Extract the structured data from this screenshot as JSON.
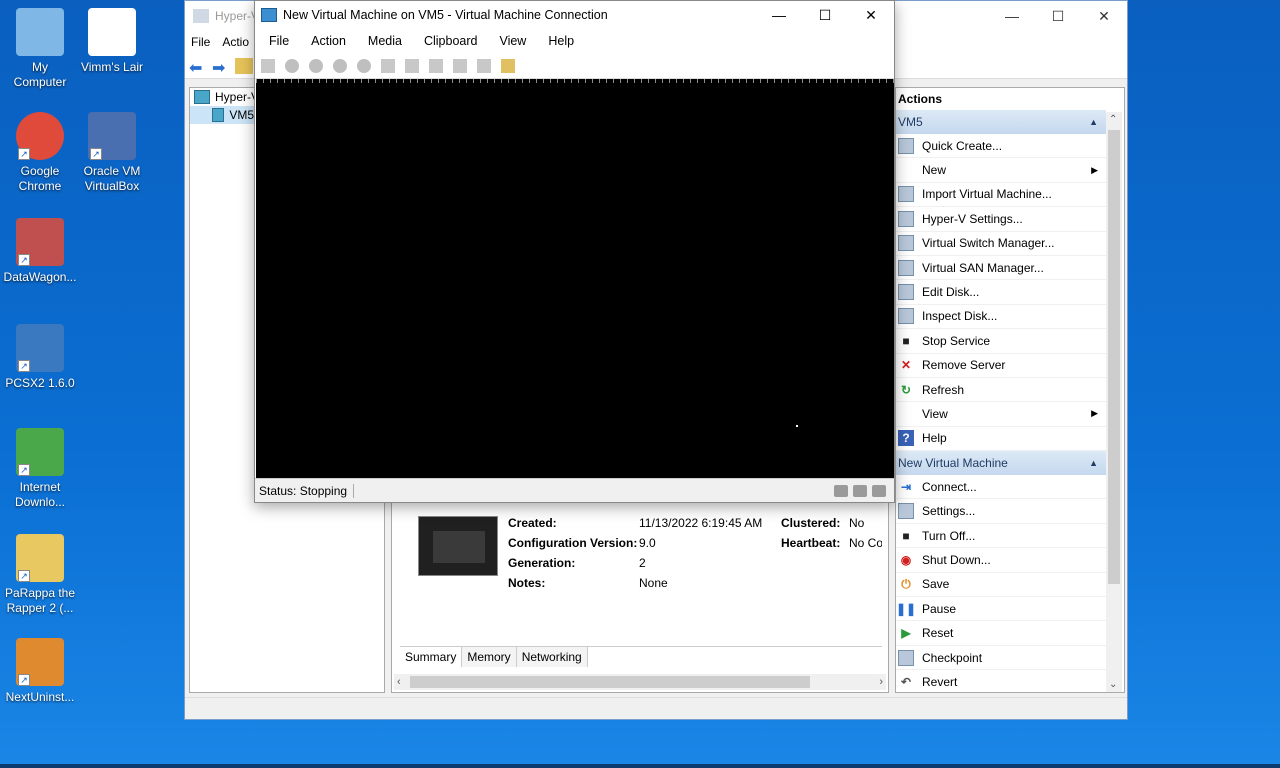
{
  "desktop": {
    "icons": [
      {
        "label": "My\nComputer",
        "name": "my-computer"
      },
      {
        "label": "Vimm's Lair",
        "name": "vimms-lair"
      },
      {
        "label": "Google\nChrome",
        "name": "google-chrome"
      },
      {
        "label": "Oracle VM\nVirtualBox",
        "name": "oracle-vm-virtualbox"
      },
      {
        "label": "DataWagon...",
        "name": "datawagon"
      },
      {
        "label": "PCSX2 1.6.0",
        "name": "pcsx2"
      },
      {
        "label": "Internet\nDownlo...",
        "name": "internet-download-manager"
      },
      {
        "label": "PaRappa the\nRapper 2 (...",
        "name": "parappa-the-rapper-2"
      },
      {
        "label": "NextUninst...",
        "name": "nextuninstaller"
      }
    ]
  },
  "manager": {
    "title": "Hyper-V",
    "menu": [
      "File",
      "Actio"
    ],
    "tree": [
      "Hyper-V",
      "VM5"
    ],
    "details": {
      "created_label": "Created:",
      "created_value": "11/13/2022 6:19:45 AM",
      "config_label": "Configuration Version:",
      "config_value": "9.0",
      "gen_label": "Generation:",
      "gen_value": "2",
      "notes_label": "Notes:",
      "notes_value": "None",
      "clustered_label": "Clustered:",
      "clustered_value": "No",
      "heartbeat_label": "Heartbeat:",
      "heartbeat_value": "No Conta"
    },
    "tabs": [
      "Summary",
      "Memory",
      "Networking"
    ],
    "actions_title": "Actions",
    "section_vm5": "VM5",
    "vm5_actions": [
      {
        "label": "Quick Create...",
        "icon": "quick-create-icon",
        "sub": false
      },
      {
        "label": "New",
        "icon": "new-icon",
        "sub": true
      },
      {
        "label": "Import Virtual Machine...",
        "icon": "import-icon",
        "sub": false
      },
      {
        "label": "Hyper-V Settings...",
        "icon": "settings-doc-icon",
        "sub": false
      },
      {
        "label": "Virtual Switch Manager...",
        "icon": "switch-icon",
        "sub": false
      },
      {
        "label": "Virtual SAN Manager...",
        "icon": "san-icon",
        "sub": false
      },
      {
        "label": "Edit Disk...",
        "icon": "edit-disk-icon",
        "sub": false
      },
      {
        "label": "Inspect Disk...",
        "icon": "inspect-disk-icon",
        "sub": false
      },
      {
        "label": "Stop Service",
        "icon": "stop-icon",
        "sub": false
      },
      {
        "label": "Remove Server",
        "icon": "remove-icon",
        "sub": false
      },
      {
        "label": "Refresh",
        "icon": "refresh-icon",
        "sub": false
      },
      {
        "label": "View",
        "icon": "view-icon",
        "sub": true
      },
      {
        "label": "Help",
        "icon": "help-icon",
        "sub": false
      }
    ],
    "section_vm": "New Virtual Machine",
    "vm_actions": [
      {
        "label": "Connect...",
        "icon": "connect-icon"
      },
      {
        "label": "Settings...",
        "icon": "settings-icon"
      },
      {
        "label": "Turn Off...",
        "icon": "turn-off-icon"
      },
      {
        "label": "Shut Down...",
        "icon": "shut-down-icon"
      },
      {
        "label": "Save",
        "icon": "save-icon"
      },
      {
        "label": "Pause",
        "icon": "pause-icon"
      },
      {
        "label": "Reset",
        "icon": "reset-icon"
      },
      {
        "label": "Checkpoint",
        "icon": "checkpoint-icon"
      },
      {
        "label": "Revert",
        "icon": "revert-icon"
      }
    ]
  },
  "vmconnect": {
    "title": "New Virtual Machine on VM5 - Virtual Machine Connection",
    "menu": [
      "File",
      "Action",
      "Media",
      "Clipboard",
      "View",
      "Help"
    ],
    "status": "Status: Stopping"
  },
  "colors": {
    "desktop": "#0b6fd3",
    "section_header": "#c5d8ee",
    "screen": "#000000"
  }
}
